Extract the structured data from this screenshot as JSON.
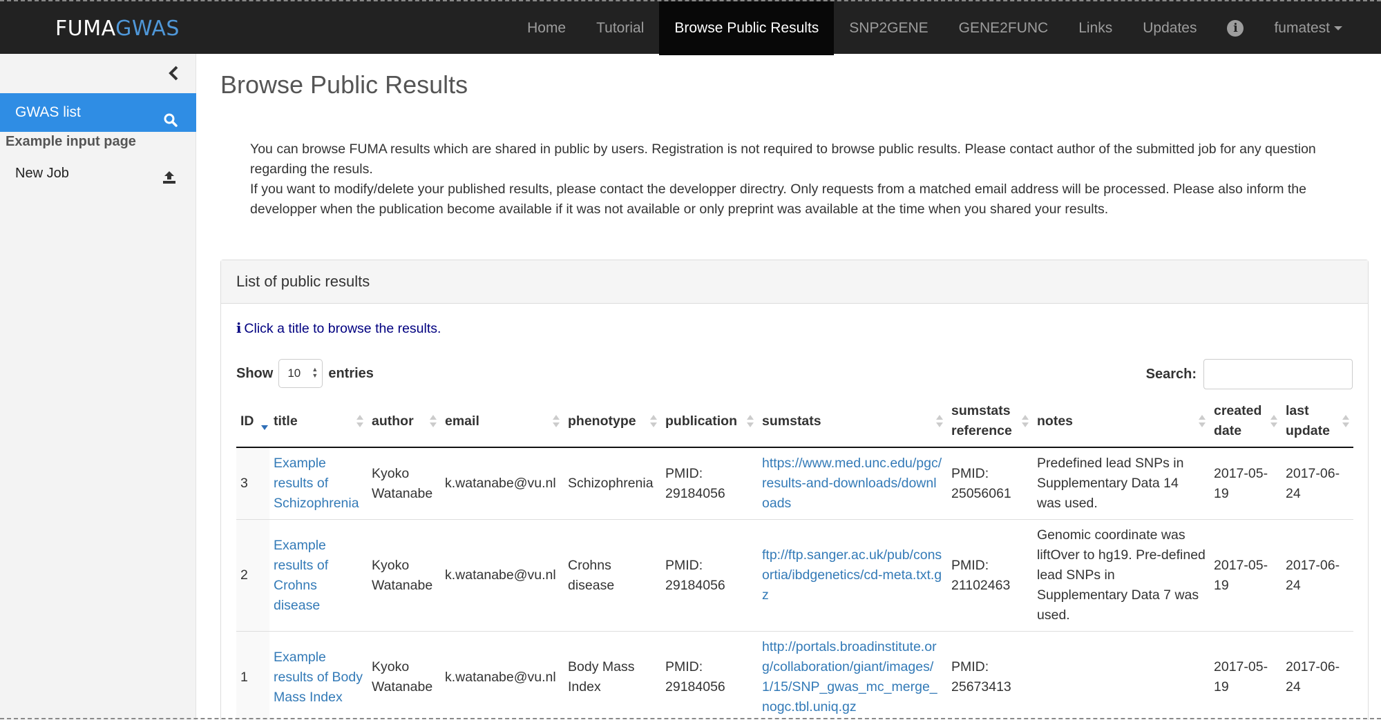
{
  "brand": {
    "part1": "FUMA",
    "part2": "GWAS"
  },
  "nav": {
    "items": [
      "Home",
      "Tutorial",
      "Browse Public Results",
      "SNP2GENE",
      "GENE2FUNC",
      "Links",
      "Updates"
    ],
    "user": "fumatest"
  },
  "sidebar": {
    "active_label": "GWAS list",
    "section_header": "Example input page",
    "new_job": "New Job"
  },
  "page": {
    "title": "Browse Public Results",
    "intro_1": "You can browse FUMA results which are shared in public by users. Registration is not required to browse public results. Please contact author of the submitted job for any question regarding the resuls.",
    "intro_2": "If you want to modify/delete your published results, please contact the developper directry. Only requests from a matched email address will be processed. Please also inform the developper when the publication become available if it was not available or only preprint was available at the time when you shared your results."
  },
  "panel": {
    "heading": "List of public results",
    "hint": "Click a title to browse the results.",
    "show_label": "Show",
    "entries_value": "10",
    "entries_label": "entries",
    "search_label": "Search:",
    "search_value": ""
  },
  "table": {
    "headers": [
      "ID",
      "title",
      "author",
      "email",
      "phenotype",
      "publication",
      "sumstats",
      "sumstats reference",
      "notes",
      "created date",
      "last update"
    ],
    "rows": [
      {
        "id": "3",
        "title": "Example results of Schizophrenia",
        "author": "Kyoko Watanabe",
        "email": "k.watanabe@vu.nl",
        "phenotype": "Schizophrenia",
        "publication": "PMID: 29184056",
        "sumstats": "https://www.med.unc.edu/pgc/results-and-downloads/downloads",
        "sumstats_ref": "PMID: 25056061",
        "notes": "Predefined lead SNPs in Supplementary Data 14 was used.",
        "created": "2017-05-19",
        "updated": "2017-06-24"
      },
      {
        "id": "2",
        "title": "Example results of Crohns disease",
        "author": "Kyoko Watanabe",
        "email": "k.watanabe@vu.nl",
        "phenotype": "Crohns disease",
        "publication": "PMID: 29184056",
        "sumstats": "ftp://ftp.sanger.ac.uk/pub/consortia/ibdgenetics/cd-meta.txt.gz",
        "sumstats_ref": "PMID: 21102463",
        "notes": "Genomic coordinate was liftOver to hg19. Pre-defined lead SNPs in Supplementary Data 7 was used.",
        "created": "2017-05-19",
        "updated": "2017-06-24"
      },
      {
        "id": "1",
        "title": "Example results of Body Mass Index",
        "author": "Kyoko Watanabe",
        "email": "k.watanabe@vu.nl",
        "phenotype": "Body Mass Index",
        "publication": "PMID: 29184056",
        "sumstats": "http://portals.broadinstitute.org/collaboration/giant/images/1/15/SNP_gwas_mc_merge_nogc.tbl.uniq.gz",
        "sumstats_ref": "PMID: 25673413",
        "notes": "",
        "created": "2017-05-19",
        "updated": "2017-06-24"
      }
    ]
  },
  "colors": {
    "navbar": "#222222",
    "active_nav": "#080808",
    "sidebar_active": "#2f8de4",
    "link": "#337ab7",
    "hint": "#000080"
  }
}
